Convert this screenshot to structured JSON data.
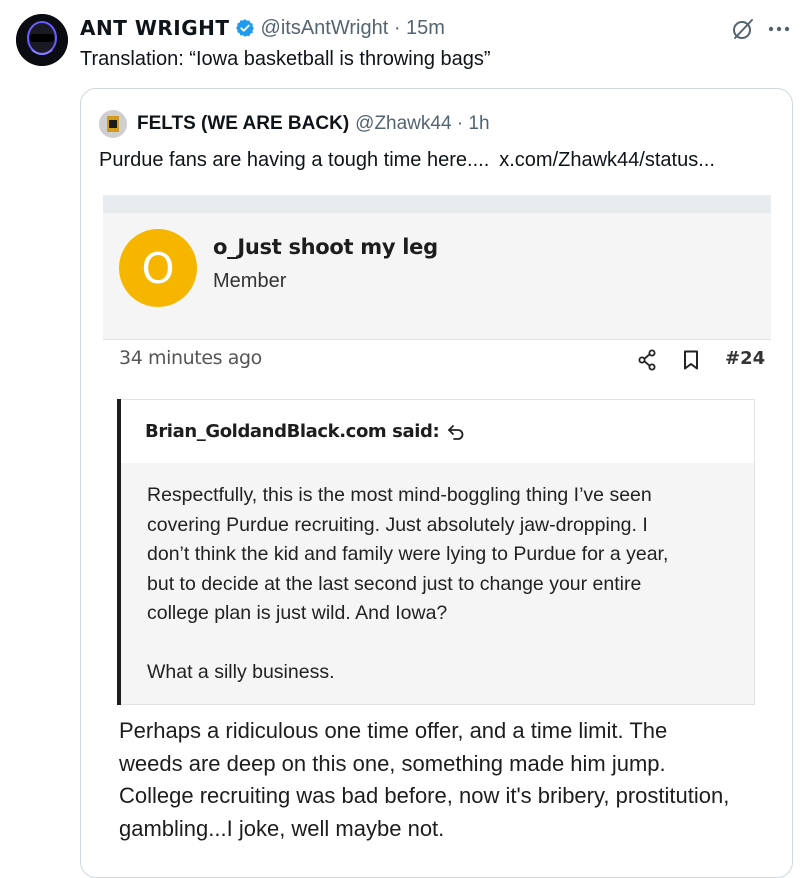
{
  "tweet": {
    "display_name": "ANT WRIGHT",
    "handle_time": "@itsAntWright · 15m",
    "text": "Translation: “Iowa basketball is throwing bags”"
  },
  "quote_tweet": {
    "display_name": "FELTS (WE ARE BACK)",
    "handle_time": "@Zhawk44 · 1h",
    "text": "Purdue fans are having a tough time here....",
    "link": "x.com/Zhawk44/status..."
  },
  "forum_post": {
    "avatar_letter": "O",
    "username": "o_Just shoot my leg",
    "role": "Member",
    "time": "34 minutes ago",
    "post_number": "#24",
    "quote_author": "Brian_GoldandBlack.com said:",
    "quote_lines": [
      "Respectfully, this is the most mind-boggling thing I’ve seen",
      "covering Purdue recruiting. Just absolutely jaw-dropping. I",
      "don’t think the kid and family were lying to Purdue for a year,",
      "but to decide at the last second just to change your entire",
      "college plan is just wild. And Iowa?"
    ],
    "quote_last": "What a silly business.",
    "reply_lines": [
      "Perhaps a ridiculous one time offer, and a time limit. The",
      "weeds are deep on this one, something made him jump.",
      "College recruiting was bad before, now it's bribery, prostitution,",
      "gambling...I joke, well maybe not."
    ]
  },
  "icons": {
    "verified": "verified-badge-icon",
    "grok": "grok-icon",
    "more": "more-icon",
    "share": "share-icon",
    "bookmark": "bookmark-icon",
    "jump": "jump-to-quote-icon"
  },
  "colors": {
    "accent": "#1d9bf0",
    "secondary_text": "#536471",
    "forum_avatar": "#f6b600"
  }
}
